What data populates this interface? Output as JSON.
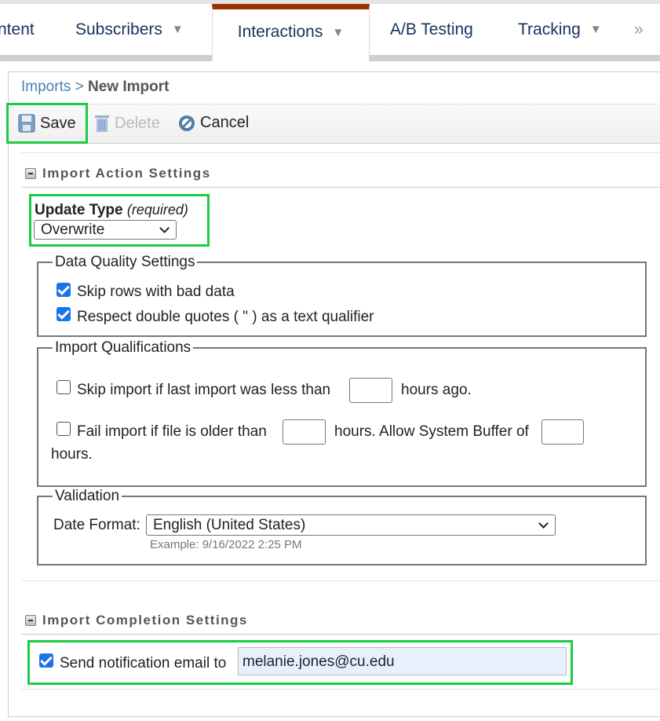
{
  "tabs": [
    {
      "label": "ntent",
      "caret": false
    },
    {
      "label": "Subscribers",
      "caret": true
    },
    {
      "label": "Interactions",
      "caret": true,
      "active": true
    },
    {
      "label": "A/B Testing",
      "caret": false
    },
    {
      "label": "Tracking",
      "caret": true
    }
  ],
  "tabs_more": "»",
  "breadcrumb": {
    "parent": "Imports",
    "separator": " > ",
    "current": "New Import"
  },
  "toolbar": {
    "save": "Save",
    "delete": "Delete",
    "cancel": "Cancel"
  },
  "action_section": {
    "title": "Import Action Settings",
    "update_type_label": "Update Type",
    "update_type_required": "(required)",
    "update_type_value": "Overwrite",
    "data_quality": {
      "legend": "Data Quality Settings",
      "skip_bad_rows": "Skip rows with bad data",
      "skip_bad_rows_checked": true,
      "respect_quotes": "Respect double quotes ( \" ) as a text qualifier",
      "respect_quotes_checked": true
    },
    "qualifications": {
      "legend": "Import Qualifications",
      "skip_import_pre": "Skip import if last import was less than",
      "skip_import_post": "hours ago.",
      "skip_import_checked": false,
      "skip_import_value": "",
      "fail_import_pre": "Fail import if file is older than",
      "fail_import_mid": "hours. Allow System Buffer of",
      "fail_import_post": "hours.",
      "fail_import_checked": false,
      "fail_hours_value": "",
      "buffer_value": ""
    },
    "validation": {
      "legend": "Validation",
      "date_format_label": "Date Format:",
      "date_format_value": "English (United States)",
      "example": "Example: 9/16/2022 2:25 PM"
    }
  },
  "completion_section": {
    "title": "Import Completion Settings",
    "notify_label": "Send notification email to",
    "notify_checked": true,
    "email": "melanie.jones@cu.edu"
  },
  "colors": {
    "active_tab": "#993300",
    "highlight": "#1ccc44",
    "link": "#4a7fb5",
    "tab_text": "#16325c"
  }
}
